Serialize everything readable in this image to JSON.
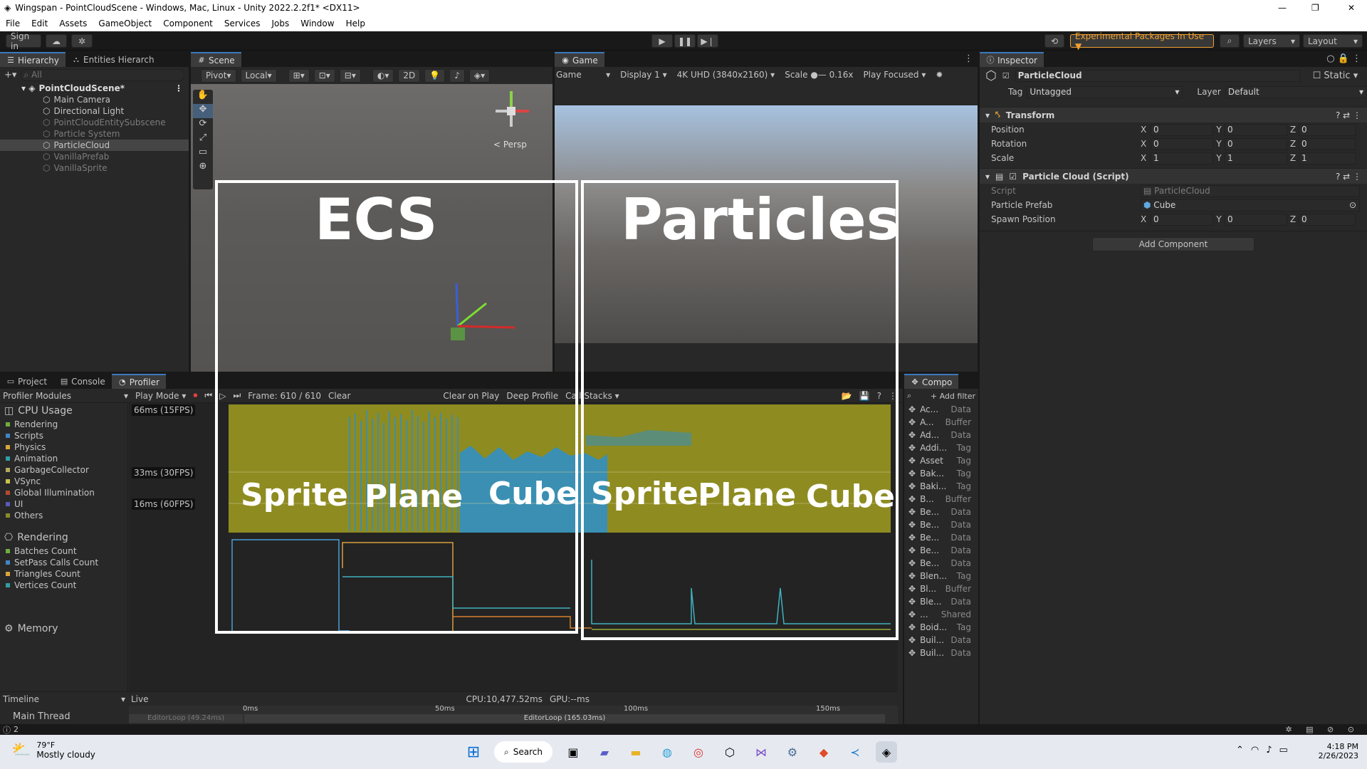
{
  "window": {
    "title": "Wingspan - PointCloudScene - Windows, Mac, Linux - Unity 2022.2.2f1* <DX11>"
  },
  "menu": [
    "File",
    "Edit",
    "Assets",
    "GameObject",
    "Component",
    "Services",
    "Jobs",
    "Window",
    "Help"
  ],
  "toolbar": {
    "signin": "Sign in",
    "experimental": "Experimental Packages In Use ▼",
    "layers": "Layers",
    "layout": "Layout"
  },
  "hierarchy": {
    "tabs": [
      "Hierarchy",
      "Entities Hierarch"
    ],
    "search_placeholder": "All",
    "scene": "PointCloudScene*",
    "items": [
      {
        "label": "Main Camera",
        "dim": false
      },
      {
        "label": "Directional Light",
        "dim": false
      },
      {
        "label": "PointCloudEntitySubscene",
        "dim": true
      },
      {
        "label": "Particle System",
        "dim": true
      },
      {
        "label": "ParticleCloud",
        "dim": false,
        "selected": true
      },
      {
        "label": "VanillaPrefab",
        "dim": true
      },
      {
        "label": "VanillaSprite",
        "dim": true
      }
    ]
  },
  "scene": {
    "tab": "Scene",
    "pivot": "Pivot",
    "local": "Local",
    "mode2d": "2D",
    "persp": "< Persp"
  },
  "game": {
    "tab": "Game",
    "view": "Game",
    "display": "Display 1",
    "resolution": "4K UHD (3840x2160)",
    "scale_label": "Scale",
    "scale_value": "0.16x",
    "play_focused": "Play Focused"
  },
  "inspector": {
    "tab": "Inspector",
    "object_name": "ParticleCloud",
    "static": "Static",
    "tag_label": "Tag",
    "tag": "Untagged",
    "layer_label": "Layer",
    "layer": "Default",
    "transform": {
      "title": "Transform",
      "position": {
        "label": "Position",
        "x": "0",
        "y": "0",
        "z": "0"
      },
      "rotation": {
        "label": "Rotation",
        "x": "0",
        "y": "0",
        "z": "0"
      },
      "scale": {
        "label": "Scale",
        "x": "1",
        "y": "1",
        "z": "1"
      }
    },
    "script": {
      "title": "Particle Cloud (Script)",
      "script_label": "Script",
      "script_value": "ParticleCloud",
      "prefab_label": "Particle Prefab",
      "prefab_value": "Cube",
      "spawn_label": "Spawn Position",
      "x": "0",
      "y": "0",
      "z": "0"
    },
    "add_component": "Add Component"
  },
  "bottom_tabs": [
    "Project",
    "Console",
    "Profiler"
  ],
  "profiler": {
    "modules": "Profiler Modules",
    "play_mode": "Play Mode",
    "frame": "Frame: 610 / 610",
    "clear": "Clear",
    "clear_on_play": "Clear on Play",
    "deep_profile": "Deep Profile",
    "call_stacks": "Call Stacks",
    "cpu": {
      "title": "CPU Usage",
      "items": [
        {
          "label": "Rendering",
          "color": "#6fae3d"
        },
        {
          "label": "Scripts",
          "color": "#3f86c6"
        },
        {
          "label": "Physics",
          "color": "#d9a63b"
        },
        {
          "label": "Animation",
          "color": "#2f9fa5"
        },
        {
          "label": "GarbageCollector",
          "color": "#b8a85a"
        },
        {
          "label": "VSync",
          "color": "#c9c24b"
        },
        {
          "label": "Global Illumination",
          "color": "#b34a2c"
        },
        {
          "label": "UI",
          "color": "#5a5ab8"
        },
        {
          "label": "Others",
          "color": "#8b8b2a"
        }
      ]
    },
    "fps": [
      "66ms (15FPS)",
      "33ms (30FPS)",
      "16ms (60FPS)"
    ],
    "rendering": {
      "title": "Rendering",
      "items": [
        {
          "label": "Batches Count",
          "color": "#6fae3d"
        },
        {
          "label": "SetPass Calls Count",
          "color": "#3f86c6"
        },
        {
          "label": "Triangles Count",
          "color": "#d9a63b"
        },
        {
          "label": "Vertices Count",
          "color": "#2f9fa5"
        }
      ]
    },
    "memory": "Memory",
    "timeline": "Timeline",
    "live": "Live",
    "cpu_stat": "CPU:10,477.52ms",
    "gpu_stat": "GPU:--ms",
    "ticks": [
      "0ms",
      "50ms",
      "100ms",
      "150ms"
    ],
    "main_thread": "Main Thread",
    "loop_small": "EditorLoop (49.24ms)",
    "loop_big": "EditorLoop (165.03ms)"
  },
  "overlay": {
    "ecs": "ECS",
    "particles": "Particles",
    "labels": [
      "Sprite",
      "Plane",
      "Cube",
      "Sprite",
      "Plane",
      "Cube"
    ]
  },
  "components": {
    "tab": "Compo",
    "add_filter": "+ Add filter",
    "items": [
      {
        "n": "Ac...",
        "t": "Data"
      },
      {
        "n": "A...",
        "t": "Buffer"
      },
      {
        "n": "Ad...",
        "t": "Data"
      },
      {
        "n": "Addi...",
        "t": "Tag"
      },
      {
        "n": "Asset",
        "t": "Tag"
      },
      {
        "n": "Bak...",
        "t": "Tag"
      },
      {
        "n": "Baki...",
        "t": "Tag"
      },
      {
        "n": "B...",
        "t": "Buffer"
      },
      {
        "n": "Be...",
        "t": "Data"
      },
      {
        "n": "Be...",
        "t": "Data"
      },
      {
        "n": "Be...",
        "t": "Data"
      },
      {
        "n": "Be...",
        "t": "Data"
      },
      {
        "n": "Be...",
        "t": "Data"
      },
      {
        "n": "Blen...",
        "t": "Tag"
      },
      {
        "n": "Bl...",
        "t": "Buffer"
      },
      {
        "n": "Ble...",
        "t": "Data"
      },
      {
        "n": "...",
        "t": "Shared"
      },
      {
        "n": "Boid...",
        "t": "Tag"
      },
      {
        "n": "Buil...",
        "t": "Data"
      },
      {
        "n": "Buil...",
        "t": "Data"
      }
    ]
  },
  "status": {
    "count": "2"
  },
  "taskbar": {
    "temp": "79°F",
    "weather": "Mostly cloudy",
    "search": "Search",
    "time": "4:18 PM",
    "date": "2/26/2023"
  }
}
